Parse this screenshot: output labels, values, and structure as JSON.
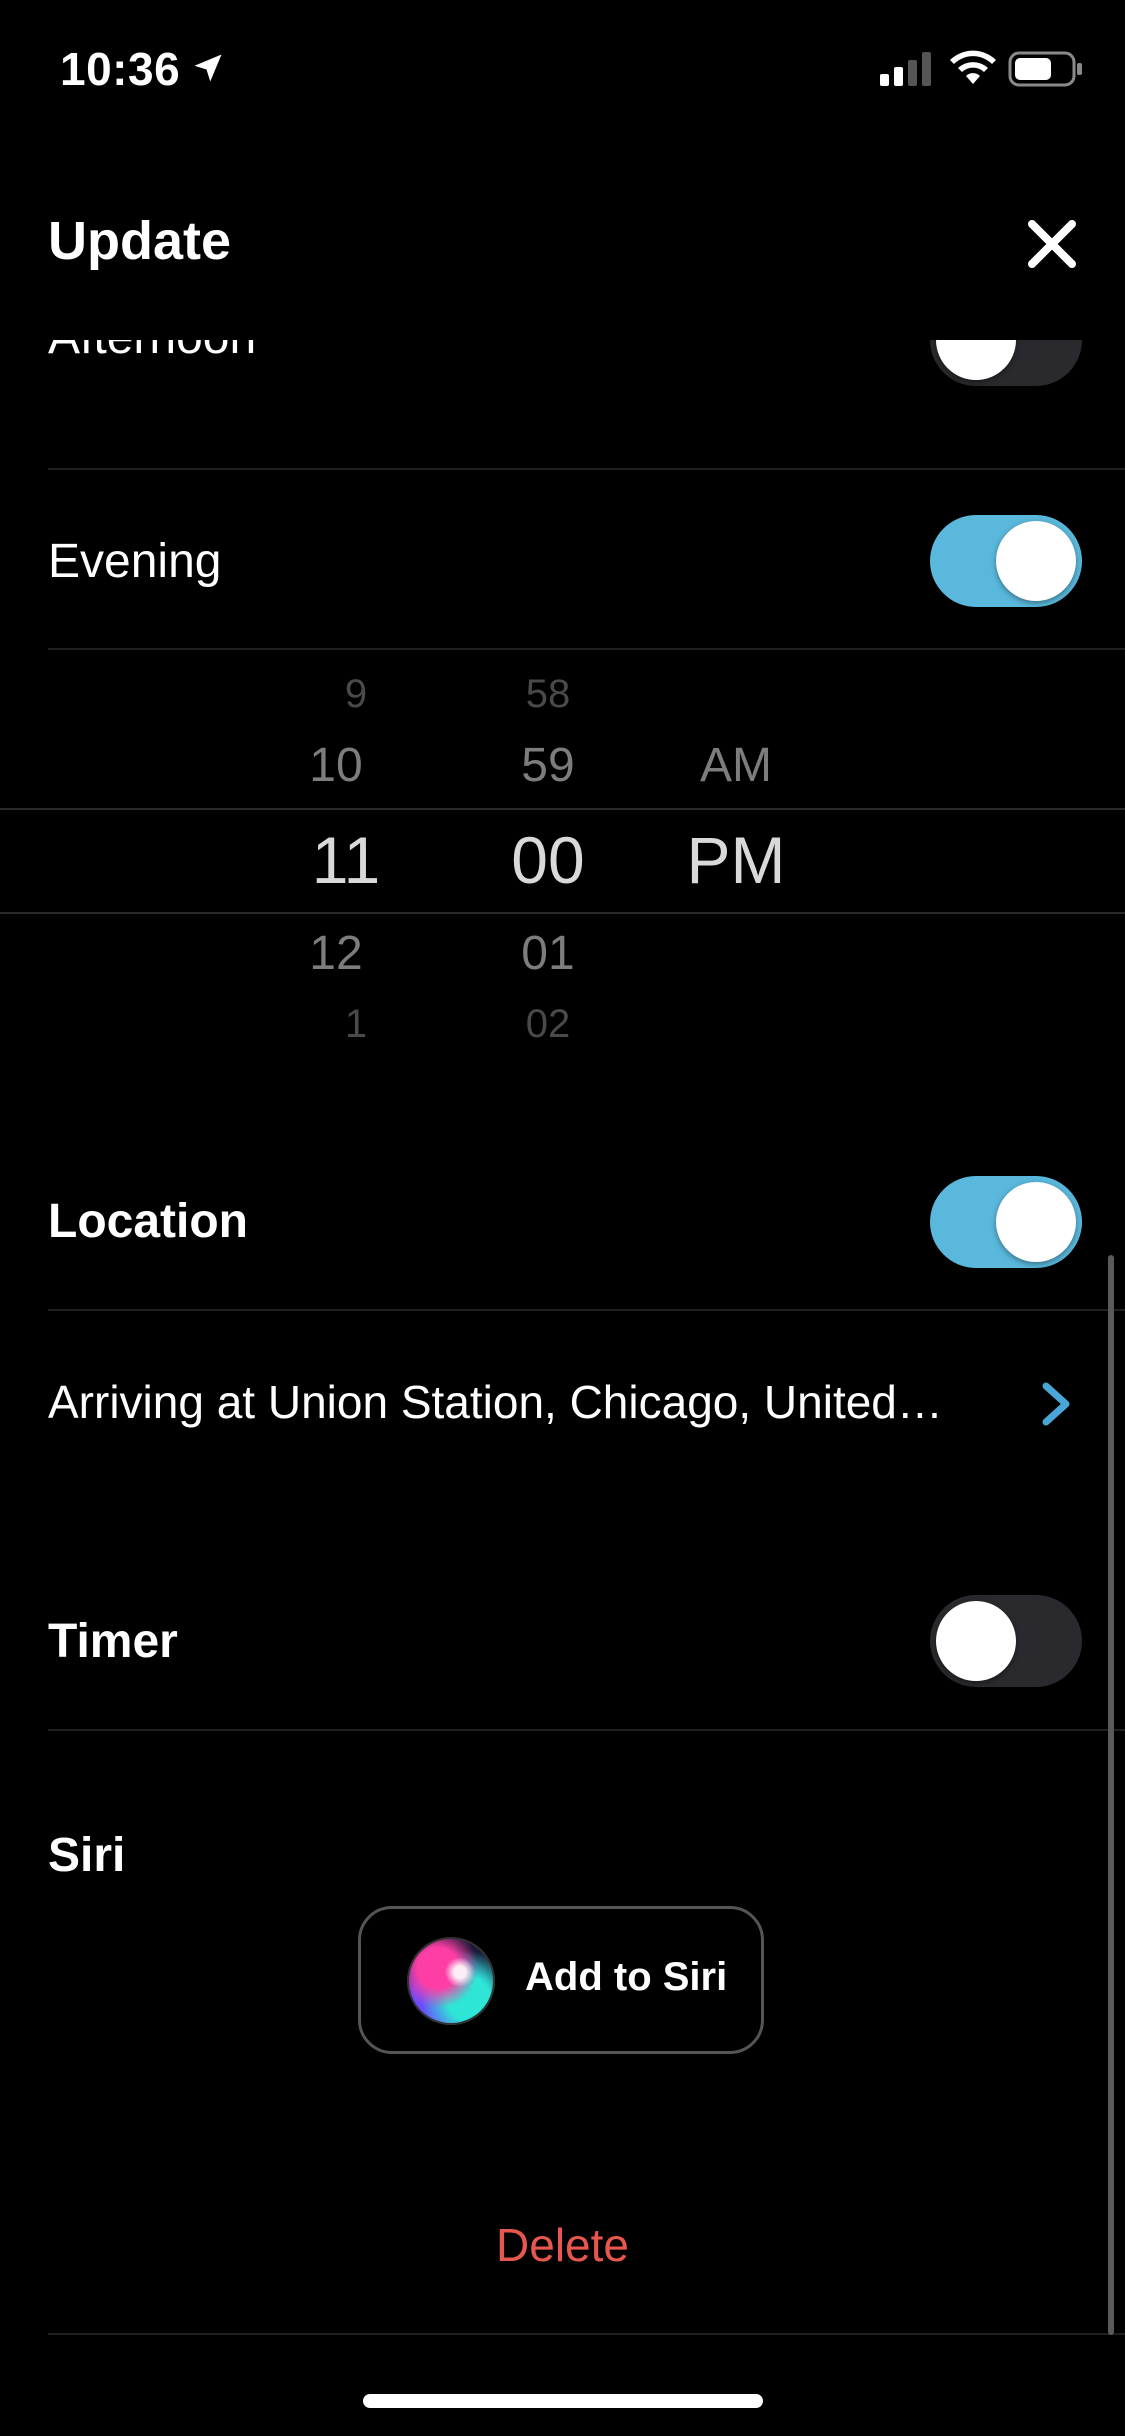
{
  "status_bar": {
    "time": "10:36",
    "icons": [
      "location-arrow-icon",
      "cellular-signal-icon",
      "wifi-icon",
      "battery-icon"
    ]
  },
  "header": {
    "title": "Update",
    "close_icon": "close-icon"
  },
  "rows": {
    "afternoon": {
      "label": "Afternoon",
      "toggle_on": false
    },
    "evening": {
      "label": "Evening",
      "toggle_on": true
    },
    "location": {
      "label": "Location",
      "toggle_on": true
    },
    "timer": {
      "label": "Timer",
      "toggle_on": false
    },
    "siri": {
      "label": "Siri"
    }
  },
  "time_picker": {
    "hours": [
      "9",
      "10",
      "11",
      "12",
      "1"
    ],
    "minutes": [
      "58",
      "59",
      "00",
      "01",
      "02"
    ],
    "period": [
      "AM",
      "PM"
    ],
    "selected": {
      "hour": "11",
      "minute": "00",
      "period": "PM"
    }
  },
  "location_detail": {
    "text": "Arriving at Union Station, Chicago, United…"
  },
  "siri_button": {
    "label": "Add to Siri"
  },
  "delete_label": "Delete",
  "colors": {
    "accent_toggle": "#5ab8dc",
    "delete": "#e8574f",
    "chevron": "#4aa6d6"
  }
}
